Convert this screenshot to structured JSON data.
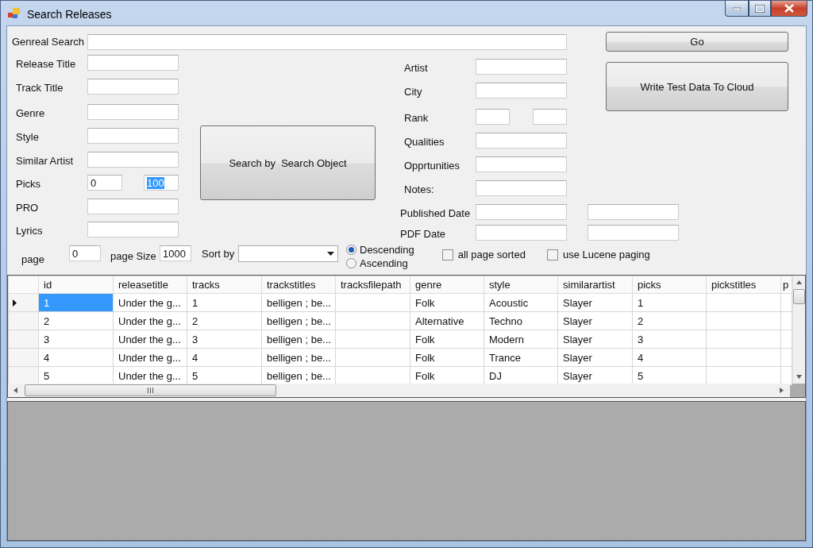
{
  "window": {
    "title": "Search Releases"
  },
  "general_search": {
    "label": "Genreal Search"
  },
  "go_button": "Go",
  "left_fields": [
    {
      "label": "Release Title",
      "kind": "single"
    },
    {
      "label": "Track Title",
      "kind": "single"
    },
    {
      "label": "Genre",
      "kind": "single"
    },
    {
      "label": "Style",
      "kind": "single"
    },
    {
      "label": "Similar Artist",
      "kind": "single"
    },
    {
      "label": "Picks",
      "kind": "range",
      "inputs": [
        {
          "value": "0",
          "highlighted": false
        },
        {
          "value": "100",
          "highlighted": true
        }
      ]
    },
    {
      "label": "PRO",
      "kind": "single"
    },
    {
      "label": "Lyrics",
      "kind": "single"
    }
  ],
  "search_button": "Search by  Search Object",
  "right_fields": [
    {
      "label": "Artist",
      "kind": "single"
    },
    {
      "label": "City",
      "kind": "single"
    },
    {
      "label": "Rank",
      "kind": "range"
    },
    {
      "label": "Qualities",
      "kind": "single"
    },
    {
      "label": "Opprtunities",
      "kind": "single"
    },
    {
      "label": "Notes:",
      "kind": "single"
    }
  ],
  "write_button": "Write Test Data To Cloud",
  "date_fields": [
    {
      "label": "Published Date",
      "kind": "wide_pair"
    },
    {
      "label": "PDF Date",
      "kind": "wide_pair"
    }
  ],
  "paging": {
    "page_label": "page",
    "page_value": "0",
    "size_label": "page Size",
    "size_value": "1000",
    "sort_label": "Sort by"
  },
  "sort_order": [
    {
      "label": "Descending",
      "selected": true
    },
    {
      "label": "Ascending",
      "selected": false
    }
  ],
  "checkboxes": [
    {
      "label": "all page sorted",
      "checked": false
    },
    {
      "label": "use Lucene paging",
      "checked": false
    }
  ],
  "table": {
    "columns": [
      "id",
      "releasetitle",
      "tracks",
      "trackstitles",
      "tracksfilepath",
      "genre",
      "style",
      "similarartist",
      "picks",
      "pickstitles",
      "p"
    ],
    "rows": [
      {
        "selected": true,
        "cells": [
          "1",
          "Under the g...",
          "1",
          "belligen ; be...",
          "",
          "Folk",
          "Acoustic",
          "Slayer",
          "1",
          ""
        ]
      },
      {
        "selected": false,
        "cells": [
          "2",
          "Under the g...",
          "2",
          "belligen ; be...",
          "",
          "Alternative",
          "Techno",
          "Slayer",
          "2",
          ""
        ]
      },
      {
        "selected": false,
        "cells": [
          "3",
          "Under the g...",
          "3",
          "belligen ; be...",
          "",
          "Folk",
          "Modern",
          "Slayer",
          "3",
          ""
        ]
      },
      {
        "selected": false,
        "cells": [
          "4",
          "Under the g...",
          "4",
          "belligen ; be...",
          "",
          "Folk",
          "Trance",
          "Slayer",
          "4",
          ""
        ]
      },
      {
        "selected": false,
        "cells": [
          "5",
          "Under the g...",
          "5",
          "belligen ; be...",
          "",
          "Folk",
          "DJ",
          "Slayer",
          "5",
          ""
        ]
      }
    ]
  }
}
